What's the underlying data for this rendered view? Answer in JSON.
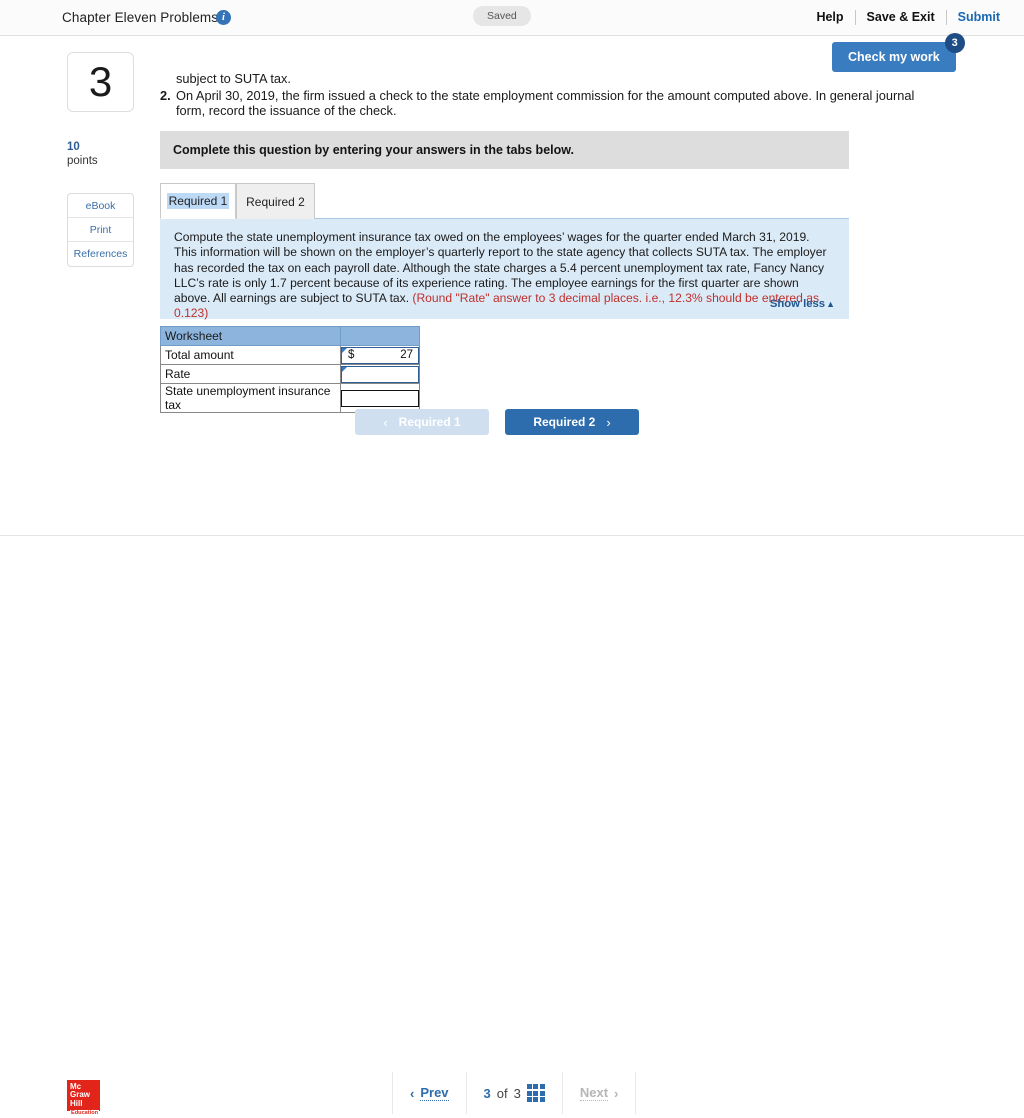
{
  "header": {
    "assignment_title": "Chapter Eleven Problems",
    "info_icon": "info-icon",
    "saved_status": "Saved",
    "help_label": "Help",
    "save_exit_label": "Save & Exit",
    "submit_label": "Submit"
  },
  "check_work": {
    "label": "Check my work",
    "badge_count": "3"
  },
  "question": {
    "number": "3",
    "points_value": "10",
    "points_label": "points",
    "rail_buttons": [
      {
        "label": "eBook"
      },
      {
        "label": "Print"
      },
      {
        "label": "References"
      }
    ],
    "stem_line_1": "subject to SUTA tax.",
    "stem_item_2_bullet": "2.",
    "stem_item_2_text": "On April 30, 2019, the firm issued a check to the state employment commission for the amount computed above. In general journal form, record the issuance of the check."
  },
  "instruction_band": {
    "text": "Complete this question by entering your answers in the tabs below."
  },
  "tabs": [
    {
      "label": "Required 1",
      "active": true
    },
    {
      "label": "Required 2",
      "active": false
    }
  ],
  "prompt": {
    "body": "Compute the state unemployment insurance tax owed on the employees’ wages for the quarter ended March 31, 2019. This information will be shown on the employer’s quarterly report to the state agency that collects SUTA tax. The employer has recorded the tax on each payroll date. Although the state charges a 5.4 percent unemployment tax rate, Fancy Nancy LLC’s rate is only 1.7 percent because of its experience rating. The employee earnings for the first quarter are shown above. All earnings are subject to SUTA tax. ",
    "red_note": "(Round \"Rate\" answer to 3 decimal places. i.e., 12.3%  should be entered as 0.123)",
    "show_less_label": "Show less",
    "show_less_caret": "▲"
  },
  "worksheet": {
    "header_label": "Worksheet",
    "header_value": "",
    "rows": [
      {
        "label": "Total amount",
        "currency": "$",
        "value": "27",
        "editable": true
      },
      {
        "label": "Rate",
        "currency": "",
        "value": "",
        "editable": true
      },
      {
        "label": "State unemployment insurance tax",
        "currency": "",
        "value": "",
        "editable": false
      }
    ]
  },
  "nav_buttons": {
    "prev_label": "Required 1",
    "prev_chevron": "‹",
    "next_label": "Required 2",
    "next_chevron": "›"
  },
  "footer": {
    "logo_line1": "Mc",
    "logo_line2": "Graw",
    "logo_line3": "Hill",
    "logo_line4": "Education",
    "prev_label": "Prev",
    "prev_chevron": "‹",
    "page_current": "3",
    "page_of": "of",
    "page_total": "3",
    "grid_icon": "grid-icon",
    "next_label": "Next",
    "next_chevron": "›"
  },
  "colors": {
    "accent_blue": "#2d6cad",
    "prompt_bg": "#dbeaf7",
    "table_header": "#8cb4dd",
    "red_note": "#c0302b",
    "logo_red": "#e1251b"
  }
}
